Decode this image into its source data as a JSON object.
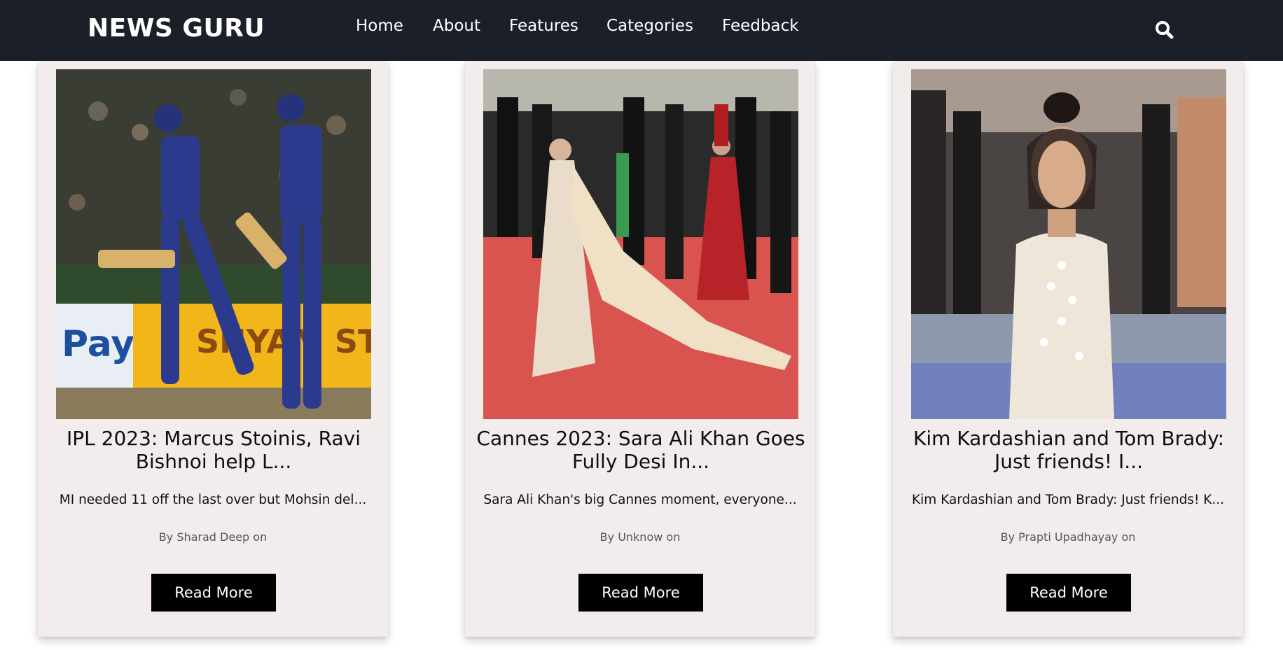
{
  "brand": "NEWS GURU",
  "nav": {
    "items": [
      {
        "label": "Home"
      },
      {
        "label": "About"
      },
      {
        "label": "Features"
      },
      {
        "label": "Categories"
      },
      {
        "label": "Feedback"
      }
    ],
    "search_icon": "search-icon"
  },
  "colors": {
    "navbar_bg": "#1b1f27",
    "card_bg": "#f2ecec",
    "button_bg": "#000000",
    "button_text": "#ffffff"
  },
  "cards": [
    {
      "image": "cricket-players-photo",
      "title": "IPL 2023: Marcus Stoinis, Ravi Bishnoi help L...",
      "description": "MI needed 11 off the last over but Mohsin del...",
      "author": "By Sharad Deep on",
      "button": "Read More"
    },
    {
      "image": "red-carpet-photo",
      "title": "Cannes 2023: Sara Ali Khan Goes Fully Desi In...",
      "description": "Sara Ali Khan's big Cannes moment, everyone...",
      "author": "By Unknow on",
      "button": "Read More"
    },
    {
      "image": "celebrity-event-photo",
      "title": "Kim Kardashian and Tom Brady: Just friends! I...",
      "description": "Kim Kardashian and Tom Brady: Just friends! K...",
      "author": "By Prapti Upadhayay on",
      "button": "Read More"
    }
  ]
}
